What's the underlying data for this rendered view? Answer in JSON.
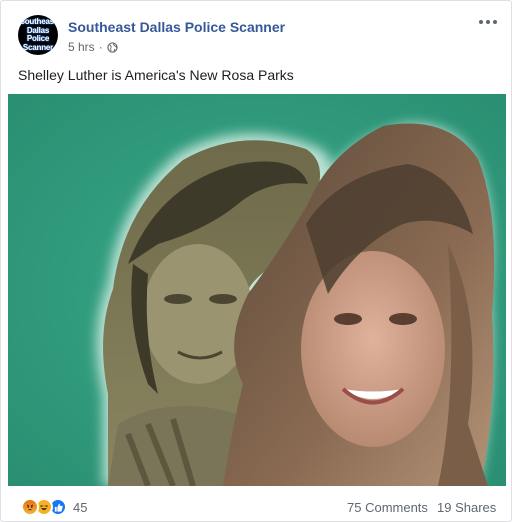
{
  "page": {
    "name": "Southeast Dallas Police Scanner",
    "avatar_lines": [
      "Southeast",
      "Dallas",
      "Police",
      "Scanner"
    ],
    "time": "5 hrs",
    "separator": "·",
    "privacy_icon": "globe-icon",
    "menu_icon": "more-icon"
  },
  "post": {
    "text": "Shelley Luther is America's New Rosa Parks"
  },
  "footer": {
    "reaction_icons": [
      "angry-icon",
      "haha-icon",
      "like-icon"
    ],
    "reaction_count": "45",
    "comments": "75 Comments",
    "shares": "19 Shares"
  },
  "colors": {
    "link": "#365899",
    "meta": "#616770",
    "photo_background": "#2f9c7e",
    "like_blue": "#1877f2"
  }
}
